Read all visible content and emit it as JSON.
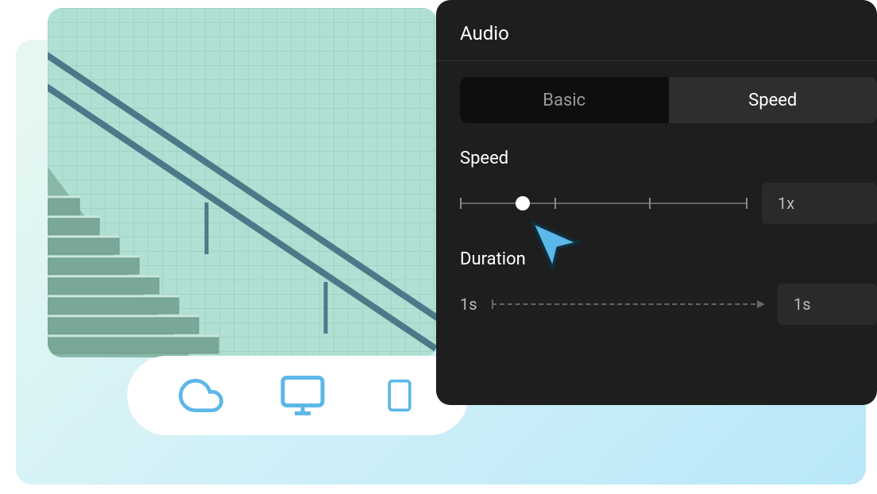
{
  "panel": {
    "title": "Audio",
    "tabs": {
      "basic": "Basic",
      "speed": "Speed"
    },
    "speed": {
      "label": "Speed",
      "value": "1x",
      "slider_position_percent": 22,
      "tick_count": 4
    },
    "duration": {
      "label": "Duration",
      "start": "1s",
      "end": "1s"
    }
  },
  "devices": {
    "cloud": "cloud-icon",
    "desktop": "desktop-icon",
    "mobile": "mobile-icon"
  },
  "colors": {
    "accent_blue": "#5bb8e8",
    "panel_bg": "#1e1e1e",
    "tab_active": "#2e2e2e",
    "value_box": "#2a2a2a"
  }
}
